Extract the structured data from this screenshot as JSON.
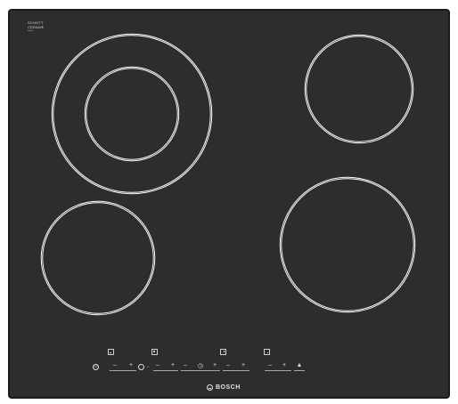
{
  "brand": {
    "line1": "SCHOTT",
    "line2": "CERAN®",
    "line3": "▪▪▪▪▪▪",
    "logo": "BOSCH"
  },
  "controls": {
    "power_symbol": "⏻",
    "minus": "–",
    "plus": "+",
    "timer_symbol": "◷",
    "lock_symbol": "▲"
  },
  "colors": {
    "glass": "#2d2d2d",
    "frame": "#1a1a1a",
    "ring": "#ffffff",
    "print": "#dcdcdc"
  },
  "icons": [
    "power-icon",
    "zone-indicator-icon",
    "timer-icon",
    "child-lock-icon",
    "bosch-logo-icon"
  ]
}
